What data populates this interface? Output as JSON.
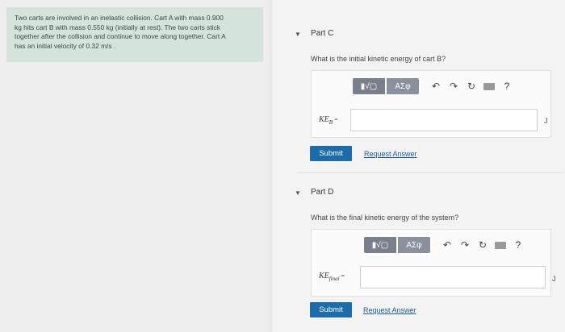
{
  "problem": {
    "lines": [
      "Two carts are involved in an inelastic collision. Cart A with mass 0.900",
      "kg hits cart B with mass 0.550 kg (initially at rest). The two carts stick",
      "together after the collision and continue to move along together. Cart A",
      "has an initial velocity of 0.32 m/s ."
    ]
  },
  "partC": {
    "title": "Part C",
    "question": "What is the initial kinetic energy of cart B?",
    "label": "KE",
    "label_sub": "B",
    "label_eq": " =",
    "unit": "J",
    "submit": "Submit",
    "request": "Request Answer"
  },
  "partD": {
    "title": "Part D",
    "question": "What is the final kinetic energy of the system?",
    "label": "KE",
    "label_sub": "final",
    "label_eq": " =",
    "unit": "J",
    "submit": "Submit",
    "request": "Request Answer"
  },
  "toolbar": {
    "math_label": "▮√▢",
    "greek_label": "ΑΣφ",
    "undo": "↶",
    "redo": "↷",
    "reset": "↻",
    "help": "?"
  },
  "icons": [
    "caret-down-icon",
    "template-icon",
    "greek-icon",
    "undo-icon",
    "redo-icon",
    "reset-icon",
    "keyboard-icon",
    "help-icon"
  ]
}
